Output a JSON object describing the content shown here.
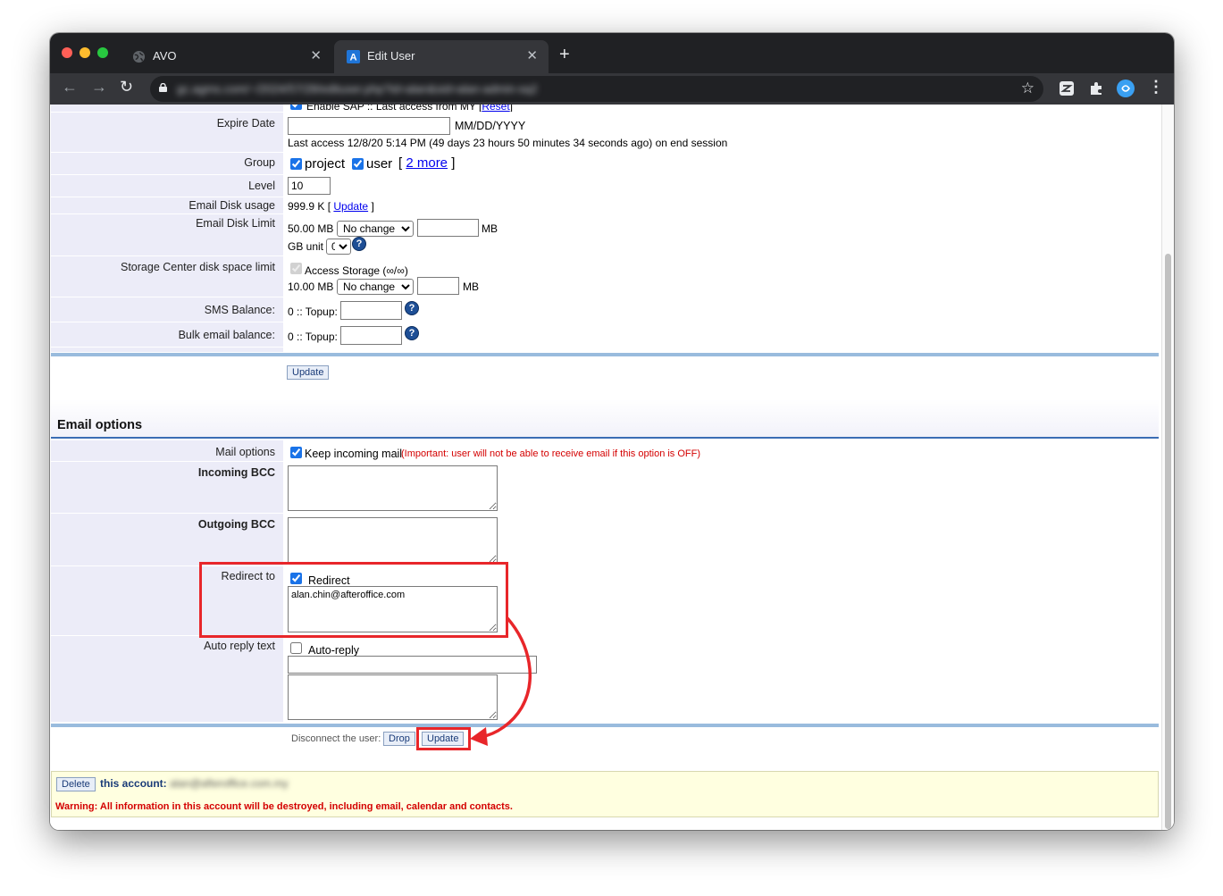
{
  "browser": {
    "tabs": [
      {
        "title": "AVO",
        "active": false
      },
      {
        "title": "Edit User",
        "active": true
      }
    ],
    "url": "gc.agms.com/~/2024/57/28/edituser.php?id=alan&sid=alan-admin-sq2"
  },
  "user_form": {
    "sap_row": {
      "text": "Enable SAP :: Last access from MY [",
      "reset": "Reset",
      "close": "]"
    },
    "expire": {
      "label": "Expire Date",
      "hint": "MM/DD/YYYY",
      "last_access": "Last access 12/8/20 5:14 PM (49 days 23 hours 50 minutes 34 seconds ago) on end session"
    },
    "group": {
      "label": "Group",
      "opt1": "project",
      "opt2": "user",
      "more_open": "[",
      "more": "2 more",
      "more_close": "]"
    },
    "level": {
      "label": "Level",
      "value": "10"
    },
    "email_disk_usage": {
      "label": "Email Disk usage",
      "value": "999.9 K [",
      "update": "Update",
      "close": "]"
    },
    "email_disk_limit": {
      "label": "Email Disk Limit",
      "current": "50.00 MB",
      "select": "No change",
      "unit": "MB",
      "gb_unit": "GB unit",
      "gb_value": "0"
    },
    "storage": {
      "label": "Storage Center disk space limit",
      "access": "Access Storage (∞/∞)",
      "current": "10.00 MB",
      "select": "No change",
      "unit": "MB"
    },
    "sms": {
      "label": "SMS Balance:",
      "value": "0 :: Topup:"
    },
    "bulk": {
      "label": "Bulk email balance:",
      "value": "0 :: Topup:"
    },
    "update_button": "Update"
  },
  "email_options": {
    "heading": "Email options",
    "mail_options": {
      "label": "Mail options",
      "keep": "Keep incoming mail",
      "warning": "(Important: user will not be able to receive email if this option is OFF)"
    },
    "incoming_bcc": {
      "label": "Incoming BCC"
    },
    "outgoing_bcc": {
      "label": "Outgoing BCC"
    },
    "redirect": {
      "label": "Redirect to",
      "checkbox_label": "Redirect",
      "address": "alan.chin@afteroffice.com"
    },
    "auto_reply": {
      "label": "Auto reply text",
      "checkbox_label": "Auto-reply"
    },
    "disconnect": {
      "label": "Disconnect the user:",
      "drop": "Drop",
      "update": "Update"
    }
  },
  "delete_section": {
    "button": "Delete",
    "label": "this account:",
    "account": "alan@afteroffice.com.my",
    "warning": "Warning: All information in this account will be destroyed, including email, calendar and contacts."
  },
  "colors": {
    "annotation": "#e8262a",
    "label_bg": "#ececf8",
    "divider": "#99bbdd",
    "warning": "#d40000"
  }
}
